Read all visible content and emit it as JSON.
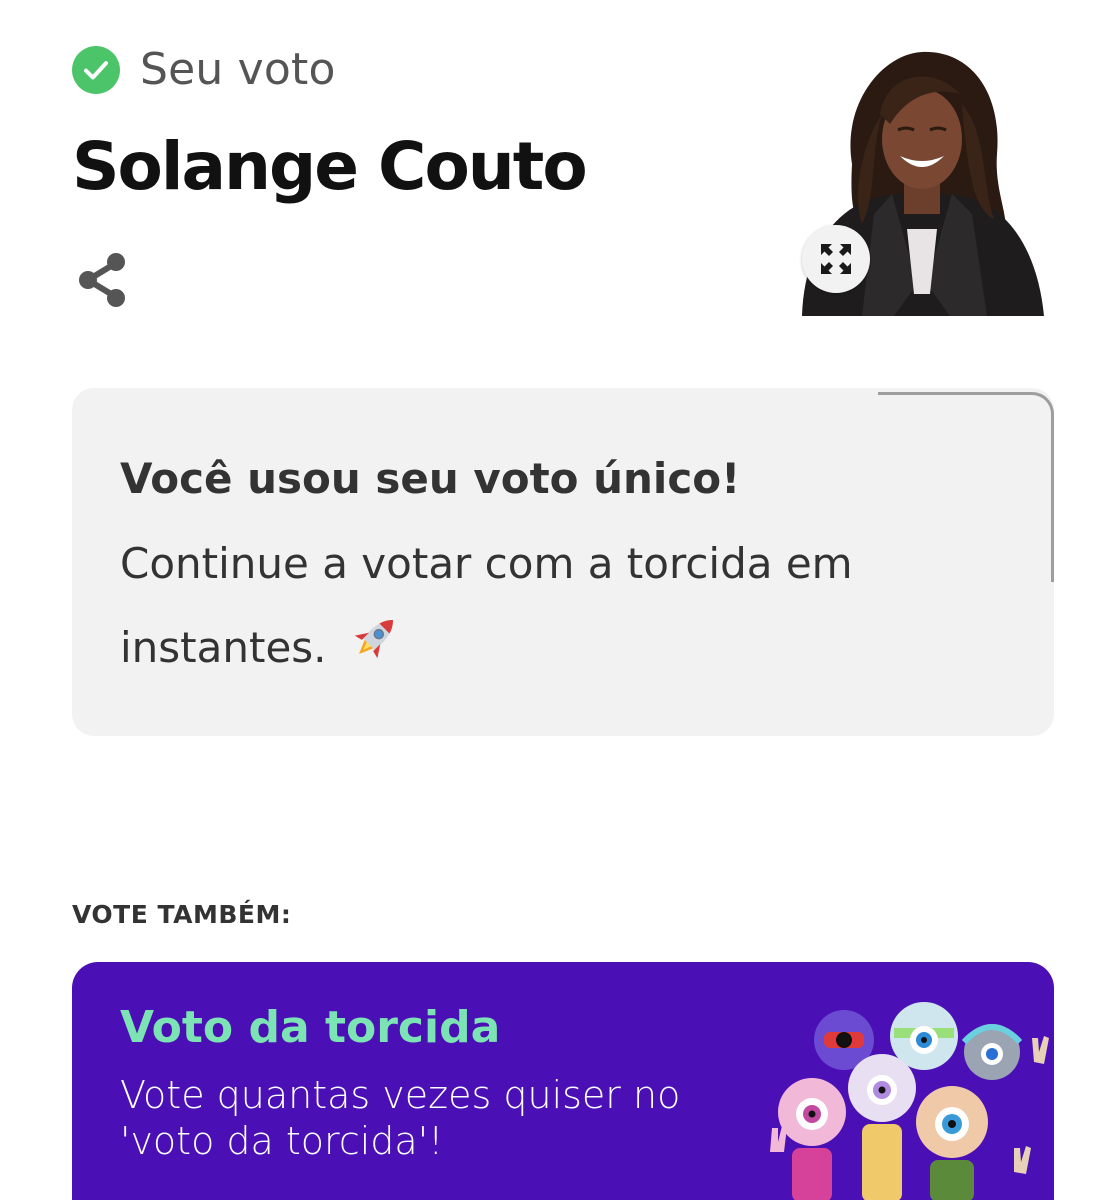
{
  "header": {
    "status_label": "Seu voto",
    "candidate_name": "Solange Couto"
  },
  "info_box": {
    "title": "Você usou seu voto único!",
    "body": "Continue a votar com a torcida em instantes."
  },
  "vote_also": {
    "label": "VOTE TAMBÉM:",
    "card_title": "Voto da torcida",
    "card_description": "Vote quantas vezes quiser no 'voto da torcida'!"
  },
  "colors": {
    "check_green": "#4cc46a",
    "card_purple": "#4a0fb5",
    "card_title_green": "#7be3b4",
    "info_bg": "#f2f2f2"
  },
  "icons": {
    "status": "check-circle-icon",
    "share": "share-icon",
    "expand": "expand-icon",
    "rocket": "rocket-icon"
  }
}
